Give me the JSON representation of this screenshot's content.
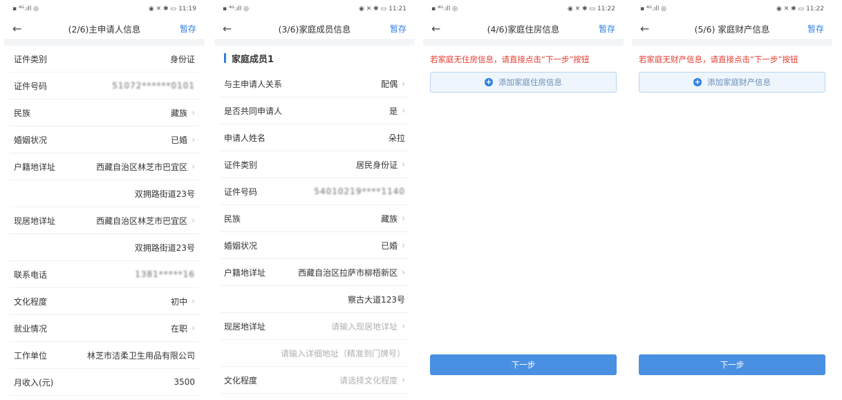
{
  "status": [
    {
      "time": "11:19"
    },
    {
      "time": "11:21"
    },
    {
      "time": "11:22"
    },
    {
      "time": "11:22"
    }
  ],
  "icons": {
    "back": "back-arrow-icon",
    "chevron": "chevron-right-icon",
    "add": "plus-circle-icon"
  },
  "colors": {
    "accent": "#2f7fde",
    "warning": "#e5392c",
    "button": "#4a90e2"
  },
  "screen1": {
    "title": "(2/6)主申请人信息",
    "save": "暂存",
    "rows": [
      {
        "label": "证件类别",
        "value": "身份证"
      },
      {
        "label": "证件号码",
        "value": "51072******0101"
      },
      {
        "label": "民族",
        "value": "藏族"
      },
      {
        "label": "婚姻状况",
        "value": "已婚"
      },
      {
        "label": "户籍地详址",
        "value": "西藏自治区林芝市巴宜区"
      },
      {
        "label": "",
        "value": "双拥路街道23号"
      },
      {
        "label": "现居地详址",
        "value": "西藏自治区林芝市巴宜区"
      },
      {
        "label": "",
        "value": "双拥路街道23号"
      },
      {
        "label": "联系电话",
        "value": "1381*****16"
      },
      {
        "label": "文化程度",
        "value": "初中"
      },
      {
        "label": "就业情况",
        "value": "在职"
      },
      {
        "label": "工作单位",
        "value": "林芝市洁柔卫生用品有限公司"
      },
      {
        "label": "月收入(元)",
        "value": "3500"
      }
    ]
  },
  "screen2": {
    "title": "(3/6)家庭成员信息",
    "save": "暂存",
    "section": "家庭成员1",
    "rows": [
      {
        "label": "与主申请人关系",
        "value": "配偶"
      },
      {
        "label": "是否共同申请人",
        "value": "是"
      },
      {
        "label": "申请人姓名",
        "value": "朵拉"
      },
      {
        "label": "证件类别",
        "value": "居民身份证"
      },
      {
        "label": "证件号码",
        "value": "54010219****1140"
      },
      {
        "label": "民族",
        "value": "藏族"
      },
      {
        "label": "婚姻状况",
        "value": "已婚"
      },
      {
        "label": "户籍地详址",
        "value": "西藏自治区拉萨市柳梧新区"
      },
      {
        "label": "",
        "value": "察古大道123号"
      },
      {
        "label": "现居地详址",
        "placeholder": "请输入现居地详址"
      },
      {
        "label": "",
        "placeholder": "请输入详细地址（精准到门牌号）"
      },
      {
        "label": "文化程度",
        "placeholder": "请选择文化程度"
      }
    ]
  },
  "screen3": {
    "title": "(4/6)家庭住房信息",
    "save": "暂存",
    "warning": "若家庭无住房信息，请直接点击“下一步”按钮",
    "add": "添加家庭住房信息",
    "next": "下一步"
  },
  "screen4": {
    "title": "(5/6) 家庭财产信息",
    "save": "暂存",
    "warning": "若家庭无财产信息，请直接点击“下一步”按钮",
    "add": "添加家庭财产信息",
    "next": "下一步"
  }
}
